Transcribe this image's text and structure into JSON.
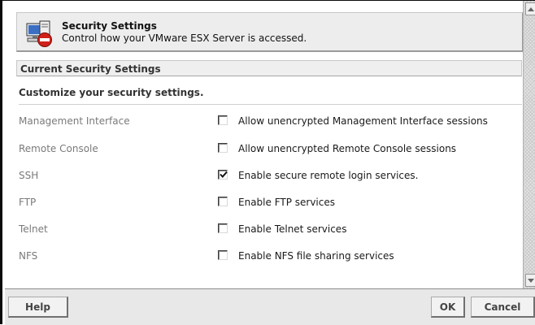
{
  "header": {
    "title": "Security Settings",
    "subtitle": "Control how your VMware ESX Server is accessed.",
    "icon": "security-computer-icon"
  },
  "section": {
    "title": "Current Security Settings",
    "customize_label": "Customize your security settings."
  },
  "settings": [
    {
      "label": "Management Interface",
      "option": "Allow unencrypted Management Interface sessions",
      "checked": false
    },
    {
      "label": "Remote Console",
      "option": "Allow unencrypted Remote Console sessions",
      "checked": false
    },
    {
      "label": "SSH",
      "option": "Enable secure remote login services.",
      "checked": true
    },
    {
      "label": "FTP",
      "option": "Enable FTP services",
      "checked": false
    },
    {
      "label": "Telnet",
      "option": "Enable Telnet services",
      "checked": false
    },
    {
      "label": "NFS",
      "option": "Enable NFS file sharing services",
      "checked": false
    }
  ],
  "footer": {
    "help_label": "Help",
    "ok_label": "OK",
    "cancel_label": "Cancel"
  },
  "colors": {
    "header_bg": "#ededed",
    "footer_bg": "#e8e8e8",
    "label_gray": "#7a7a7a",
    "icon_red": "#d0201a",
    "icon_blue": "#3a6fc4"
  }
}
